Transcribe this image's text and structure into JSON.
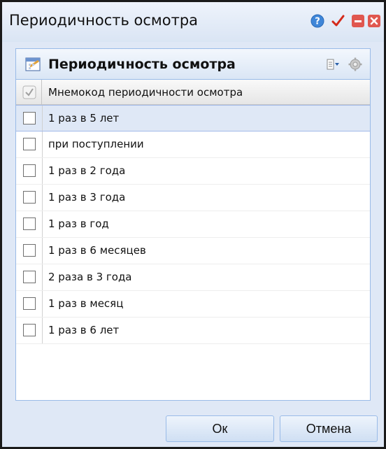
{
  "window": {
    "title": "Периодичность осмотра",
    "icons": [
      "help-icon",
      "apply-check-icon",
      "minimize-icon",
      "close-icon"
    ],
    "colors": {
      "help": "#3f86d8",
      "check": "#d42a1a",
      "window_buttons": "#e0574f"
    }
  },
  "panel": {
    "title": "Периодичность осмотра",
    "header_icons": [
      "columns-menu-icon",
      "settings-gear-icon"
    ]
  },
  "grid": {
    "column_header": "Мнемокод периодичности осмотра",
    "rows": [
      {
        "label": "1 раз в 5 лет",
        "selected": true
      },
      {
        "label": "при поступлении"
      },
      {
        "label": "1 раз в 2 года"
      },
      {
        "label": "1 раз в 3 года"
      },
      {
        "label": "1 раз в год"
      },
      {
        "label": "1 раз в 6 месяцев"
      },
      {
        "label": "2 раза в 3 года"
      },
      {
        "label": "1 раз в месяц"
      },
      {
        "label": "1 раз в 6 лет"
      }
    ]
  },
  "buttons": {
    "ok": "Ок",
    "cancel": "Отмена"
  }
}
